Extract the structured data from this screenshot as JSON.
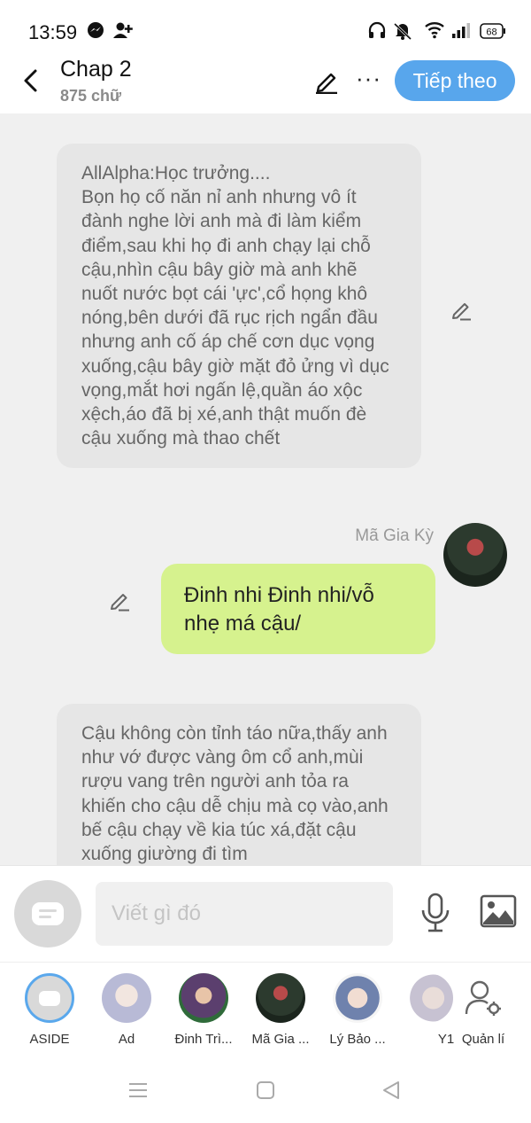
{
  "status": {
    "time": "13:59",
    "battery": "68",
    "icons": [
      "messenger-icon",
      "add-friend-icon",
      "headphones-icon",
      "mute-icon",
      "wifi-icon",
      "signal-icon",
      "battery-icon"
    ]
  },
  "header": {
    "title": "Chap 2",
    "subtitle": "875 chữ",
    "next_label": "Tiếp theo",
    "more_label": "···"
  },
  "messages": [
    {
      "side": "left",
      "text": "AllAlpha:Học trưởng....\nBọn họ cố năn nỉ anh nhưng vô ít đành nghe lời anh mà đi làm kiểm điểm,sau khi họ đi anh chạy lại chỗ cậu,nhìn cậu bây giờ mà anh khẽ nuốt nước bọt cái 'ực',cổ họng khô nóng,bên dưới đã rục rịch ngẩn đầu nhưng anh cố áp chế cơn dục vọng xuống,cậu bây giờ mặt đỏ ửng vì dục vọng,mắt hơi ngấn lệ,quần áo xộc xệch,áo đã bị xé,anh thật muốn đè cậu xuống mà thao chết"
    },
    {
      "side": "right",
      "sender": "Mã Gia Kỳ",
      "text": "Đinh nhi Đinh nhi/vỗ nhẹ má cậu/"
    },
    {
      "side": "left",
      "text": "Cậu không còn tỉnh táo nữa,thấy anh như vớ được vàng ôm cổ anh,mùi rượu vang trên người anh tỏa ra khiến cho cậu dễ chịu mà cọ vào,anh bế cậu chạy về kia túc xá,đặt cậu xuống giường đi tìm"
    }
  ],
  "composer": {
    "placeholder": "Viết gì đó"
  },
  "characters": [
    {
      "name": "ASIDE",
      "color": "#d9d9d9"
    },
    {
      "name": "Ad",
      "color": "#c9cbe0"
    },
    {
      "name": "Đinh Trì...",
      "color": "#7a5a8c"
    },
    {
      "name": "Mã Gia ...",
      "color": "#3a2a2a"
    },
    {
      "name": "Lý Bảo ...",
      "color": "#6d7fa8"
    },
    {
      "name": "Y1",
      "color": "#cfc8d6"
    },
    {
      "name": "Quản lí",
      "color": "#888888"
    }
  ],
  "colors": {
    "accent": "#58a6ec",
    "green_bubble": "#d6f28e",
    "gray_bubble": "#e6e6e6",
    "chat_bg": "#f0f0f0"
  }
}
